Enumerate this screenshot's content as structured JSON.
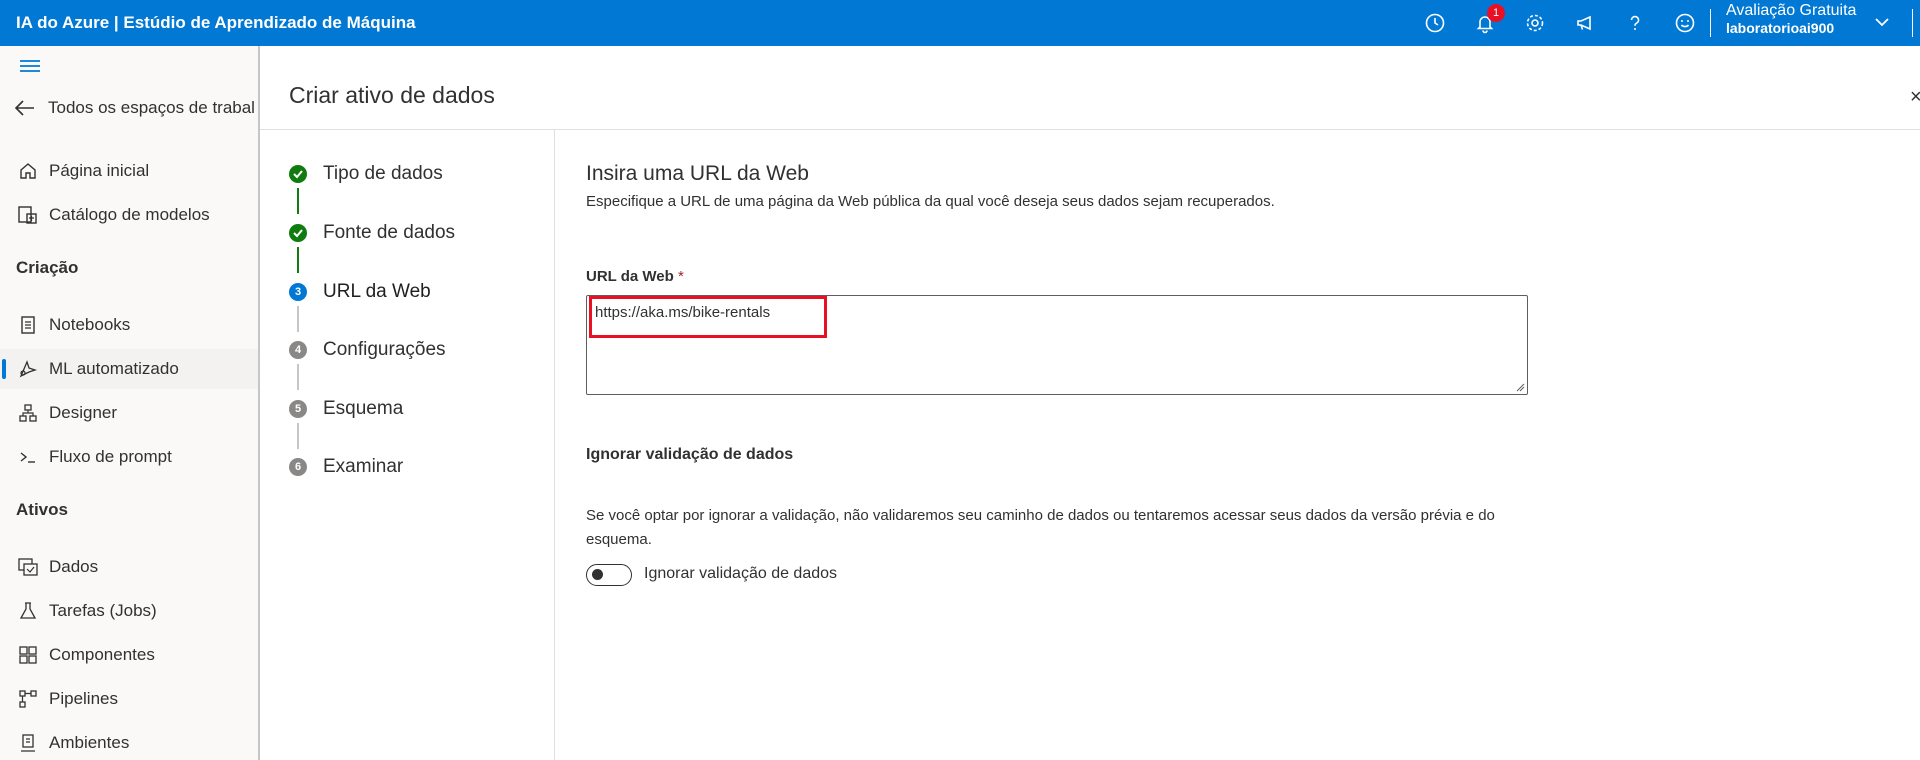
{
  "header": {
    "app_title": "IA do Azure | Estúdio de Aprendizado de Máquina",
    "notification_count": "1",
    "account_plan": "Avaliação Gratuita",
    "account_user": "laboratorioai900",
    "icons": [
      "history-icon",
      "bell-icon",
      "settings-icon",
      "feedback-megaphone-icon",
      "help-icon",
      "smiley-icon",
      "chevron-down-icon"
    ]
  },
  "sidebar": {
    "back_label": "Todos os espaços de trabal",
    "items_top": [
      {
        "label": "Página inicial",
        "icon": "home-icon"
      },
      {
        "label": "Catálogo de modelos",
        "icon": "model-catalog-icon"
      }
    ],
    "section_creation": "Criação",
    "items_creation": [
      {
        "label": "Notebooks",
        "icon": "notebook-icon"
      },
      {
        "label": "ML automatizado",
        "icon": "automl-icon",
        "active": true
      },
      {
        "label": "Designer",
        "icon": "designer-icon"
      },
      {
        "label": "Fluxo de prompt",
        "icon": "prompt-flow-icon"
      }
    ],
    "section_assets": "Ativos",
    "items_assets": [
      {
        "label": "Dados",
        "icon": "data-icon"
      },
      {
        "label": "Tarefas (Jobs)",
        "icon": "flask-icon"
      },
      {
        "label": "Componentes",
        "icon": "components-icon"
      },
      {
        "label": "Pipelines",
        "icon": "pipelines-icon"
      },
      {
        "label": "Ambientes",
        "icon": "environments-icon"
      }
    ]
  },
  "panel": {
    "title": "Criar ativo de dados",
    "close": "×",
    "steps": [
      {
        "label": "Tipo de dados",
        "status": "done"
      },
      {
        "label": "Fonte de dados",
        "status": "done"
      },
      {
        "label": "URL da Web",
        "status": "current",
        "number": "3"
      },
      {
        "label": "Configurações",
        "status": "future",
        "number": "4"
      },
      {
        "label": "Esquema",
        "status": "future",
        "number": "5"
      },
      {
        "label": "Examinar",
        "status": "future",
        "number": "6"
      }
    ]
  },
  "form": {
    "title": "Insira uma URL da Web",
    "description": "Especifique a URL de uma página da Web pública da qual você deseja seus dados sejam recuperados.",
    "url_label": "URL da Web",
    "required_mark": "*",
    "url_value": "https://aka.ms/bike-rentals",
    "ignore_title": "Ignorar validação de dados",
    "ignore_description": "Se você optar por ignorar a validação, não validaremos seu caminho de dados ou tentaremos acessar seus dados da versão prévia e do esquema.",
    "toggle_label": "Ignorar validação de dados",
    "toggle_on": false
  },
  "colors": {
    "brand": "#0078d4",
    "done": "#107c10",
    "highlight": "#e81123"
  }
}
